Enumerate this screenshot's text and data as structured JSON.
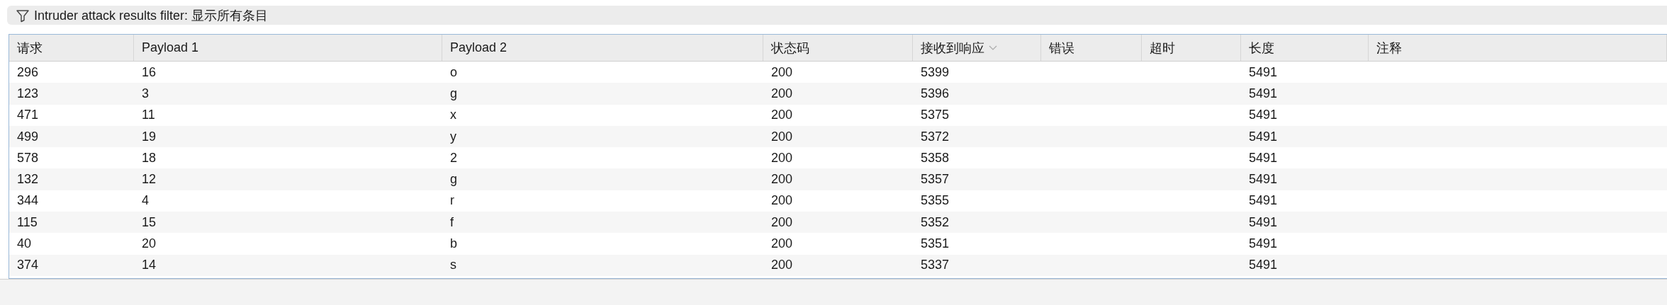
{
  "filter_bar": {
    "label": "Intruder attack results filter: 显示所有条目"
  },
  "table": {
    "columns": [
      {
        "label": "请求",
        "sorted": false
      },
      {
        "label": "Payload 1",
        "sorted": false
      },
      {
        "label": "Payload 2",
        "sorted": false
      },
      {
        "label": "状态码",
        "sorted": false
      },
      {
        "label": "接收到响应",
        "sorted": true
      },
      {
        "label": "错误",
        "sorted": false
      },
      {
        "label": "超时",
        "sorted": false
      },
      {
        "label": "长度",
        "sorted": false
      },
      {
        "label": "注释",
        "sorted": false
      }
    ],
    "rows": [
      [
        "296",
        "16",
        "o",
        "200",
        "5399",
        "",
        "",
        "5491",
        ""
      ],
      [
        "123",
        "3",
        "g",
        "200",
        "5396",
        "",
        "",
        "5491",
        ""
      ],
      [
        "471",
        "11",
        "x",
        "200",
        "5375",
        "",
        "",
        "5491",
        ""
      ],
      [
        "499",
        "19",
        "y",
        "200",
        "5372",
        "",
        "",
        "5491",
        ""
      ],
      [
        "578",
        "18",
        "2",
        "200",
        "5358",
        "",
        "",
        "5491",
        ""
      ],
      [
        "132",
        "12",
        "g",
        "200",
        "5357",
        "",
        "",
        "5491",
        ""
      ],
      [
        "344",
        "4",
        "r",
        "200",
        "5355",
        "",
        "",
        "5491",
        ""
      ],
      [
        "115",
        "15",
        "f",
        "200",
        "5352",
        "",
        "",
        "5491",
        ""
      ],
      [
        "40",
        "20",
        "b",
        "200",
        "5351",
        "",
        "",
        "5491",
        ""
      ],
      [
        "374",
        "14",
        "s",
        "200",
        "5337",
        "",
        "",
        "5491",
        ""
      ]
    ]
  }
}
